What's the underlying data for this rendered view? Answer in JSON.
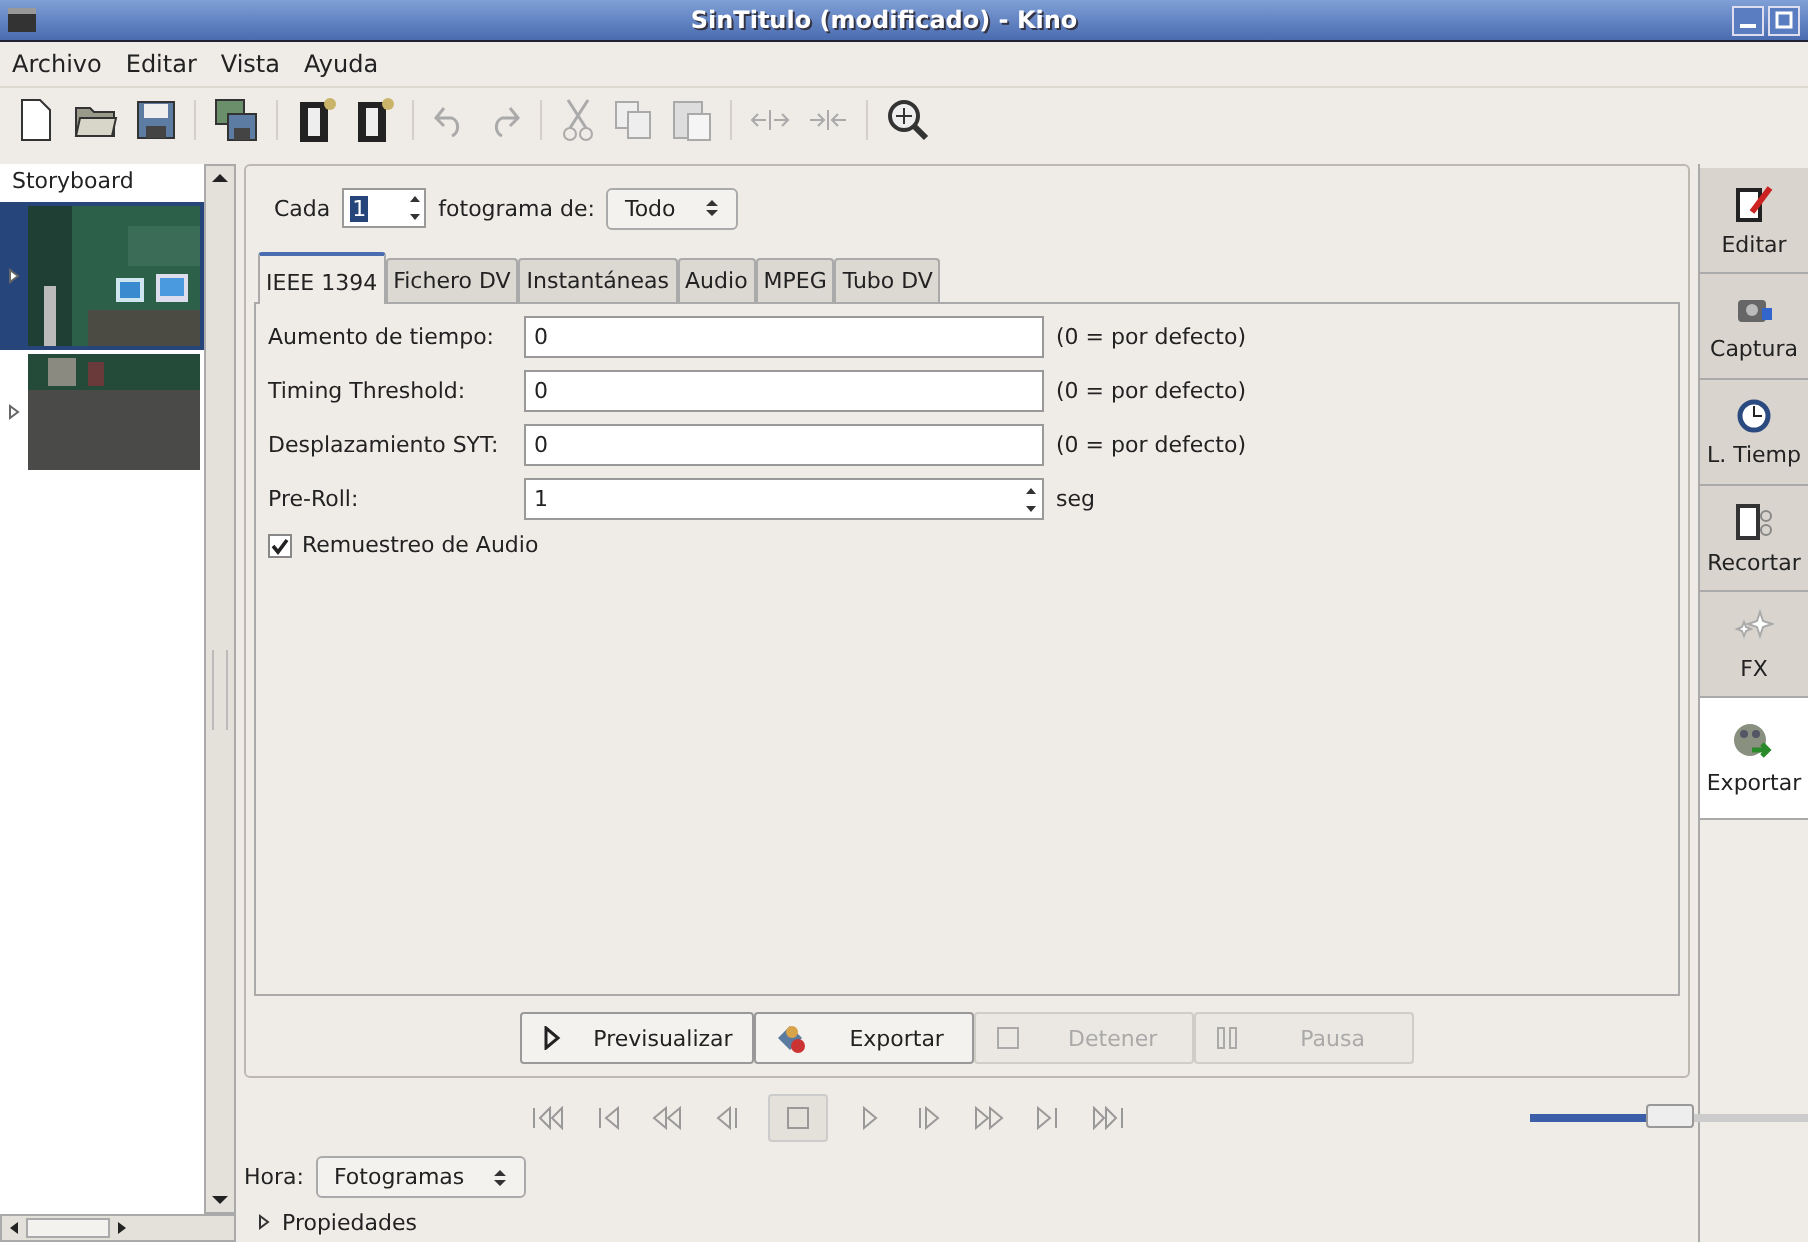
{
  "window": {
    "title": "SinTitulo (modificado)  - Kino"
  },
  "menu": {
    "items": [
      "Archivo",
      "Editar",
      "Vista",
      "Ayuda"
    ]
  },
  "storyboard": {
    "title": "Storyboard",
    "clips": [
      {
        "kind": "picture",
        "selected": true
      },
      {
        "kind": "picture",
        "selected": false
      }
    ]
  },
  "options": {
    "every_label": "Cada",
    "every_value": "1",
    "frames_label": "fotograma de:",
    "frames_select": "Todo"
  },
  "tabs": [
    {
      "label": "IEEE 1394",
      "selected": true
    },
    {
      "label": "Fichero DV",
      "selected": false
    },
    {
      "label": "Instantáneas",
      "selected": false
    },
    {
      "label": "Audio",
      "selected": false
    },
    {
      "label": "MPEG",
      "selected": false
    },
    {
      "label": "Tubo DV",
      "selected": false
    }
  ],
  "fields": [
    {
      "kind": "text",
      "label": "Aumento de tiempo:",
      "value": "0",
      "hint": "(0 = por defecto)"
    },
    {
      "kind": "text",
      "label": "Timing Threshold:",
      "value": "0",
      "hint": "(0 = por defecto)"
    },
    {
      "kind": "text",
      "label": "Desplazamiento SYT:",
      "value": "0",
      "hint": "(0 = por defecto)"
    },
    {
      "kind": "spin",
      "label": "Pre-Roll:",
      "value": "1",
      "hint": "seg"
    }
  ],
  "checkbox": {
    "label": "Remuestreo de Audio",
    "checked": true
  },
  "action_buttons": [
    {
      "kind": "play",
      "label": "Previsualizar",
      "disabled": false
    },
    {
      "kind": "export",
      "label": "Exportar",
      "disabled": false
    },
    {
      "kind": "stop",
      "label": "Detener",
      "disabled": true
    },
    {
      "kind": "pause",
      "label": "Pausa",
      "disabled": true
    }
  ],
  "position_slider": {
    "level": 0.5
  },
  "time": {
    "label": "Hora:",
    "select": "Fotogramas"
  },
  "properties": {
    "label": "Propiedades",
    "expanded": false
  },
  "sidebar": {
    "items": [
      {
        "kind": "edit",
        "label": "Editar",
        "selected": false
      },
      {
        "kind": "capture",
        "label": "Captura",
        "selected": false
      },
      {
        "kind": "clock",
        "label": "L. Tiemp",
        "selected": false
      },
      {
        "kind": "trim",
        "label": "Recortar",
        "selected": false
      },
      {
        "kind": "fx",
        "label": "FX",
        "selected": false
      },
      {
        "kind": "export",
        "label": "Exportar",
        "selected": true
      }
    ]
  }
}
